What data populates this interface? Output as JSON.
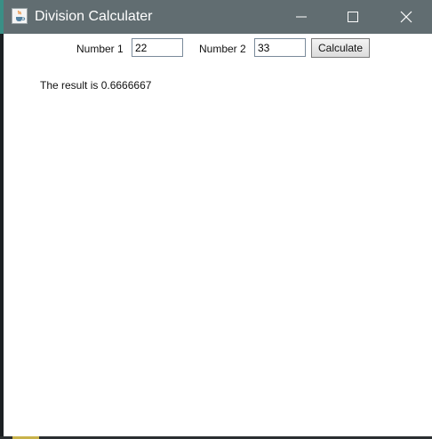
{
  "window": {
    "title": "Division Calculater",
    "icon": "java-coffee-icon",
    "controls": {
      "minimize_icon": "minimize-icon",
      "maximize_icon": "maximize-icon",
      "close_icon": "close-icon"
    },
    "titlebar_color": "#616d71"
  },
  "form": {
    "number1_label": "Number 1",
    "number1_value": "22",
    "number2_label": "Number 2",
    "number2_value": "33",
    "calculate_label": "Calculate"
  },
  "result": {
    "text": "The result is 0.6666667"
  }
}
